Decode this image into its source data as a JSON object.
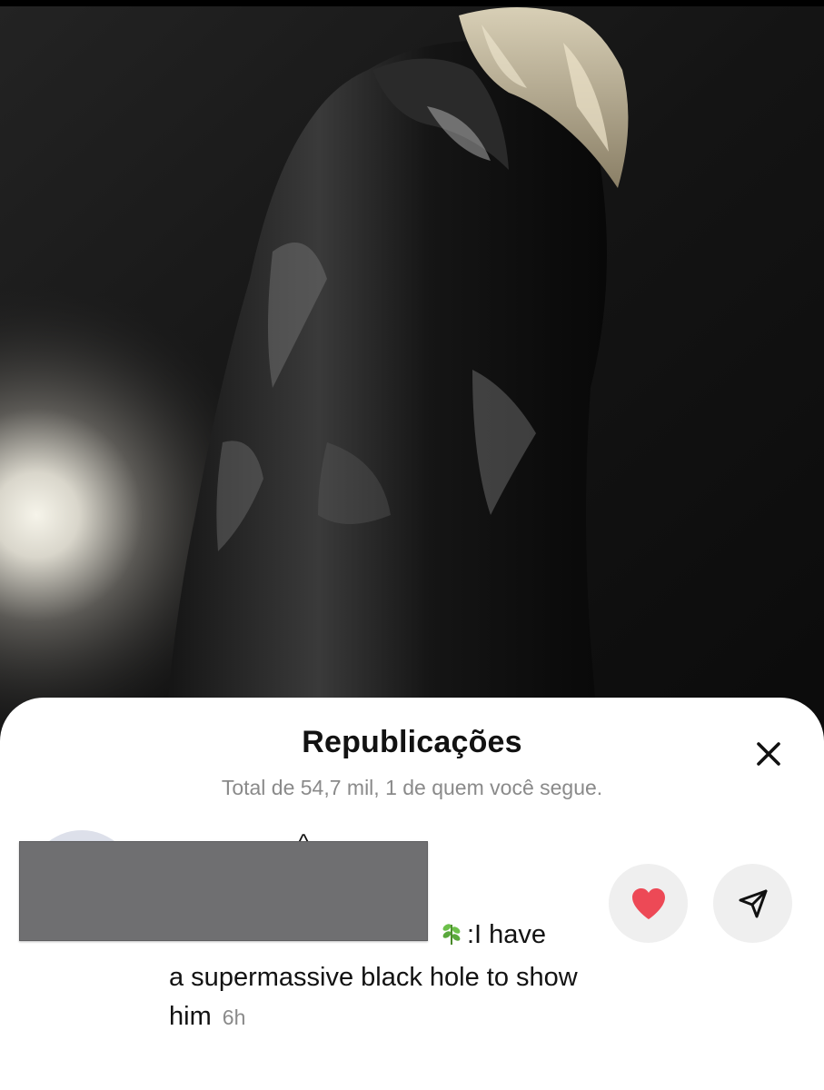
{
  "sheet": {
    "title": "Republicações",
    "subtitle": "Total de 54,7 mil, 1 de quem você segue."
  },
  "entry": {
    "username_fragment": "^",
    "comment_lead": ":I have",
    "comment_rest": "a supermassive black hole to show him",
    "time": "6h",
    "emoji_icon": "herb-icon"
  },
  "actions": {
    "like_icon": "heart-icon",
    "like_color": "#ed4956",
    "share_icon": "paper-plane-icon",
    "close_icon": "close-icon"
  }
}
